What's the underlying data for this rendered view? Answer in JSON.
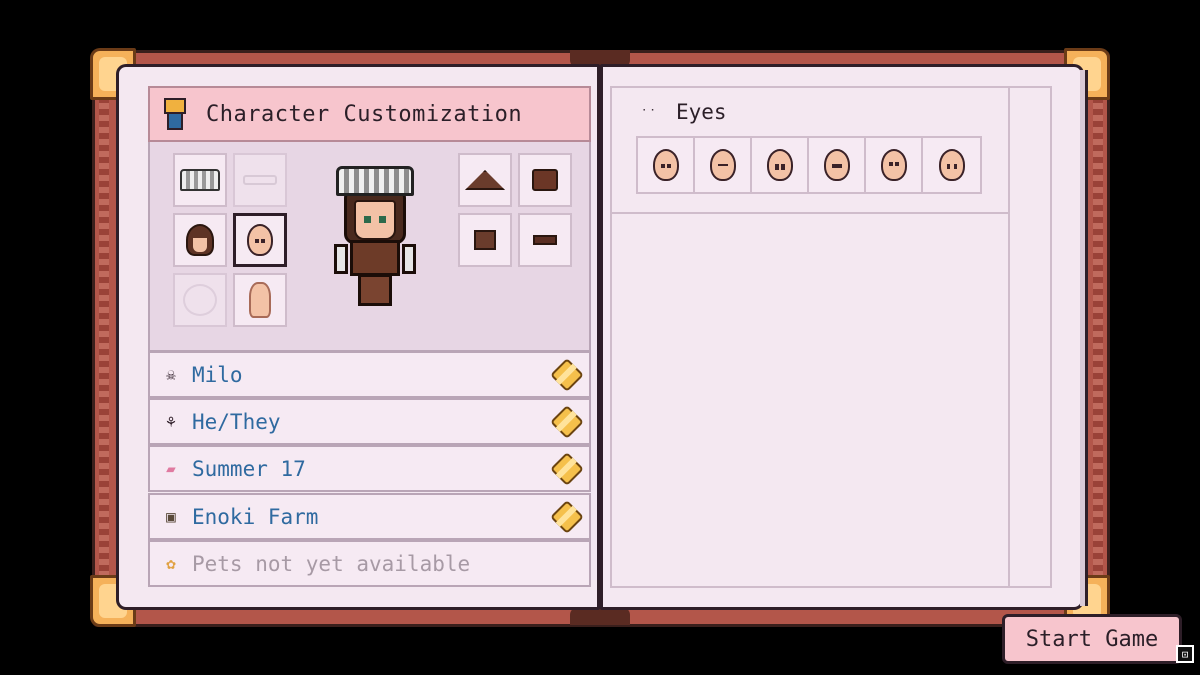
{
  "left_page": {
    "header": {
      "title": "Character Customization",
      "icon": "shirt-icon"
    },
    "info_rows": [
      {
        "icon": "skull-icon",
        "text": "Milo",
        "editable": true
      },
      {
        "icon": "pronouns-icon",
        "text": "He/They",
        "editable": true
      },
      {
        "icon": "cake-icon",
        "text": "Summer 17",
        "editable": true
      },
      {
        "icon": "farm-icon",
        "text": "Enoki Farm",
        "editable": true
      },
      {
        "icon": "paw-icon",
        "text": "Pets not yet available",
        "editable": false
      }
    ]
  },
  "right_page": {
    "section_title": "Eyes",
    "section_icon": "eyes-icon",
    "eye_option_count": 6
  },
  "start_button": {
    "label": "Start Game",
    "key_hint": "⊡"
  },
  "colors": {
    "header_bg": "#f7c5cd",
    "page_bg": "#f4e8f1",
    "text_blue": "#2f6aa0",
    "cover": "#b3564a",
    "corner": "#f5b15a"
  }
}
